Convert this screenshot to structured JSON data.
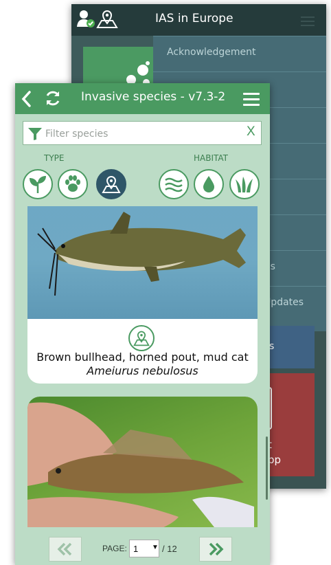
{
  "back_screen": {
    "title": "IAS in Europe",
    "drawer_items": [
      "Acknowledgement",
      "",
      "",
      "",
      "",
      "",
      "ates",
      "e Updates"
    ],
    "blue_tile_text": "s",
    "red_tile_text_line1": "t",
    "red_tile_text_line2": "pp"
  },
  "front_screen": {
    "title": "Invasive species - v7.3-2",
    "filter": {
      "placeholder": "Filter species",
      "clear_label": "X"
    },
    "type_label": "TYPE",
    "habitat_label": "HABITAT",
    "type_buttons": [
      "plant-icon",
      "animal-paw-icon",
      "map-location-icon"
    ],
    "habitat_buttons": [
      "marine-waves-icon",
      "freshwater-drop-icon",
      "terrestrial-grass-icon"
    ],
    "species": [
      {
        "common_name": "Brown bullhead, horned pout, mud cat",
        "latin_name": "Ameiurus nebulosus",
        "type_icon": "map-location-icon"
      },
      {
        "common_name": "",
        "latin_name": ""
      }
    ],
    "pagination": {
      "page_label": "PAGE:",
      "current_page": "1",
      "total": "/ 12"
    }
  },
  "colors": {
    "front_header": "#4a9a61",
    "front_background": "#bcdcc6",
    "back_header": "#253b3b",
    "drawer": "#466b75",
    "active_filter": "#2f5668",
    "red_tile": "#9a3d3d",
    "blue_tile": "#3f6284"
  }
}
